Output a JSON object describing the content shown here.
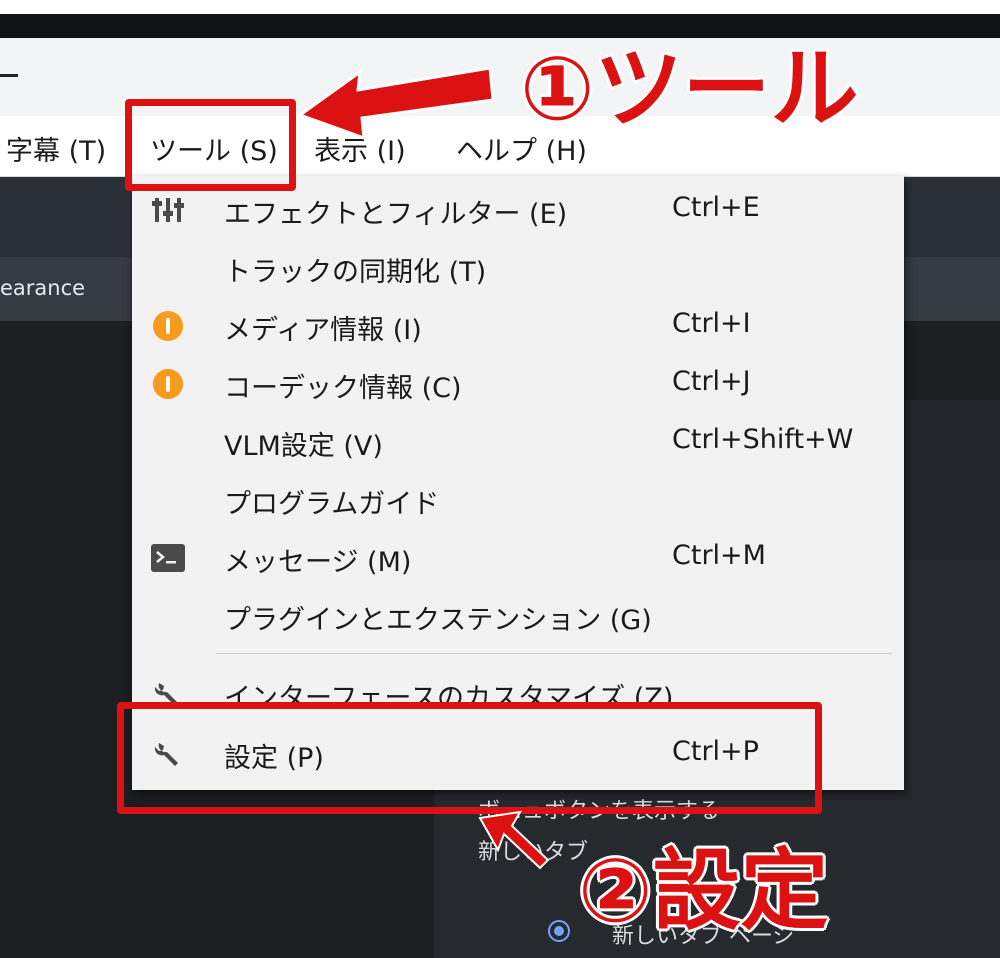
{
  "menu_bar": {
    "items": [
      {
        "label": "字幕 (T)"
      },
      {
        "label": "ツール (S)"
      },
      {
        "label": "表示 (I)"
      },
      {
        "label": "ヘルプ (H)"
      }
    ]
  },
  "background": {
    "tab_label": "earance",
    "partial_text_1": "ボ…ュボタンを表示する",
    "partial_text_2": "新しいタブ",
    "radio_label": "新しいタブ ページ"
  },
  "tools_menu": {
    "items": [
      {
        "label": "エフェクトとフィルター (E)",
        "shortcut": "Ctrl+E",
        "icon": "sliders-icon"
      },
      {
        "label": "トラックの同期化 (T)",
        "shortcut": "",
        "icon": ""
      },
      {
        "label": "メディア情報 (I)",
        "shortcut": "Ctrl+I",
        "icon": "info-icon"
      },
      {
        "label": "コーデック情報 (C)",
        "shortcut": "Ctrl+J",
        "icon": "info-icon"
      },
      {
        "label": "VLM設定 (V)",
        "shortcut": "Ctrl+Shift+W",
        "icon": ""
      },
      {
        "label": "プログラムガイド",
        "shortcut": "",
        "icon": ""
      },
      {
        "label": "メッセージ (M)",
        "shortcut": "Ctrl+M",
        "icon": "terminal-icon"
      },
      {
        "label": "プラグインとエクステンション (G)",
        "shortcut": "",
        "icon": ""
      },
      {
        "label": "インターフェースのカスタマイズ (Z)",
        "shortcut": "",
        "icon": "wrench-icon"
      },
      {
        "label": "設定 (P)",
        "shortcut": "Ctrl+P",
        "icon": "wrench-icon"
      }
    ]
  },
  "annotations": {
    "step1": "①ツール",
    "step2": "②設定",
    "color": "#dc1212"
  },
  "colors": {
    "menu_bg": "#f2f2f2",
    "info_orange": "#f59b1e",
    "dark_bg": "#1c1e21"
  }
}
